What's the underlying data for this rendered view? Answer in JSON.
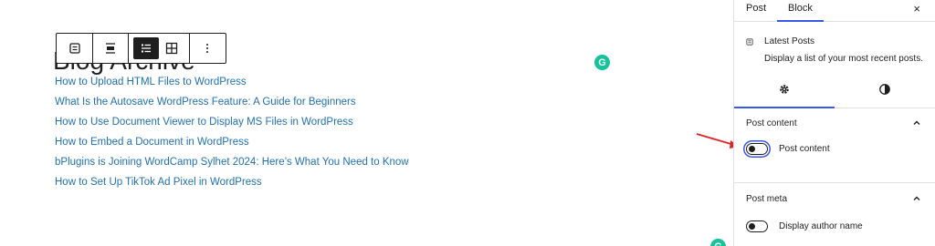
{
  "editor": {
    "heading": "Blog Archive",
    "posts": [
      "How to Upload HTML Files to WordPress",
      "What Is the Autosave WordPress Feature: A Guide for Beginners",
      "How to Use Document Viewer to Display MS Files in WordPress",
      "How to Embed a Document in WordPress",
      "bPlugins is Joining WordCamp Sylhet 2024: Here’s What You Need to Know",
      "How to Set Up TikTok Ad Pixel in WordPress"
    ],
    "grammarly_letter": "G"
  },
  "toolbar": {
    "icons": [
      "block-type-icon",
      "align-icon",
      "list-view-icon",
      "grid-view-icon",
      "more-options-icon"
    ]
  },
  "sidebar": {
    "tabs": {
      "post": "Post",
      "block": "Block"
    },
    "close": "×",
    "block_card": {
      "title": "Latest Posts",
      "description": "Display a list of your most recent posts."
    },
    "panels": {
      "post_content": {
        "title": "Post content",
        "toggle_label": "Post content",
        "toggle_on": false
      },
      "post_meta": {
        "title": "Post meta",
        "toggle_label": "Display author name",
        "toggle_on": false
      }
    }
  },
  "colors": {
    "link": "#2271b1",
    "accent": "#3858e9",
    "arrow": "#e02424",
    "grammarly": "#15c39a"
  }
}
